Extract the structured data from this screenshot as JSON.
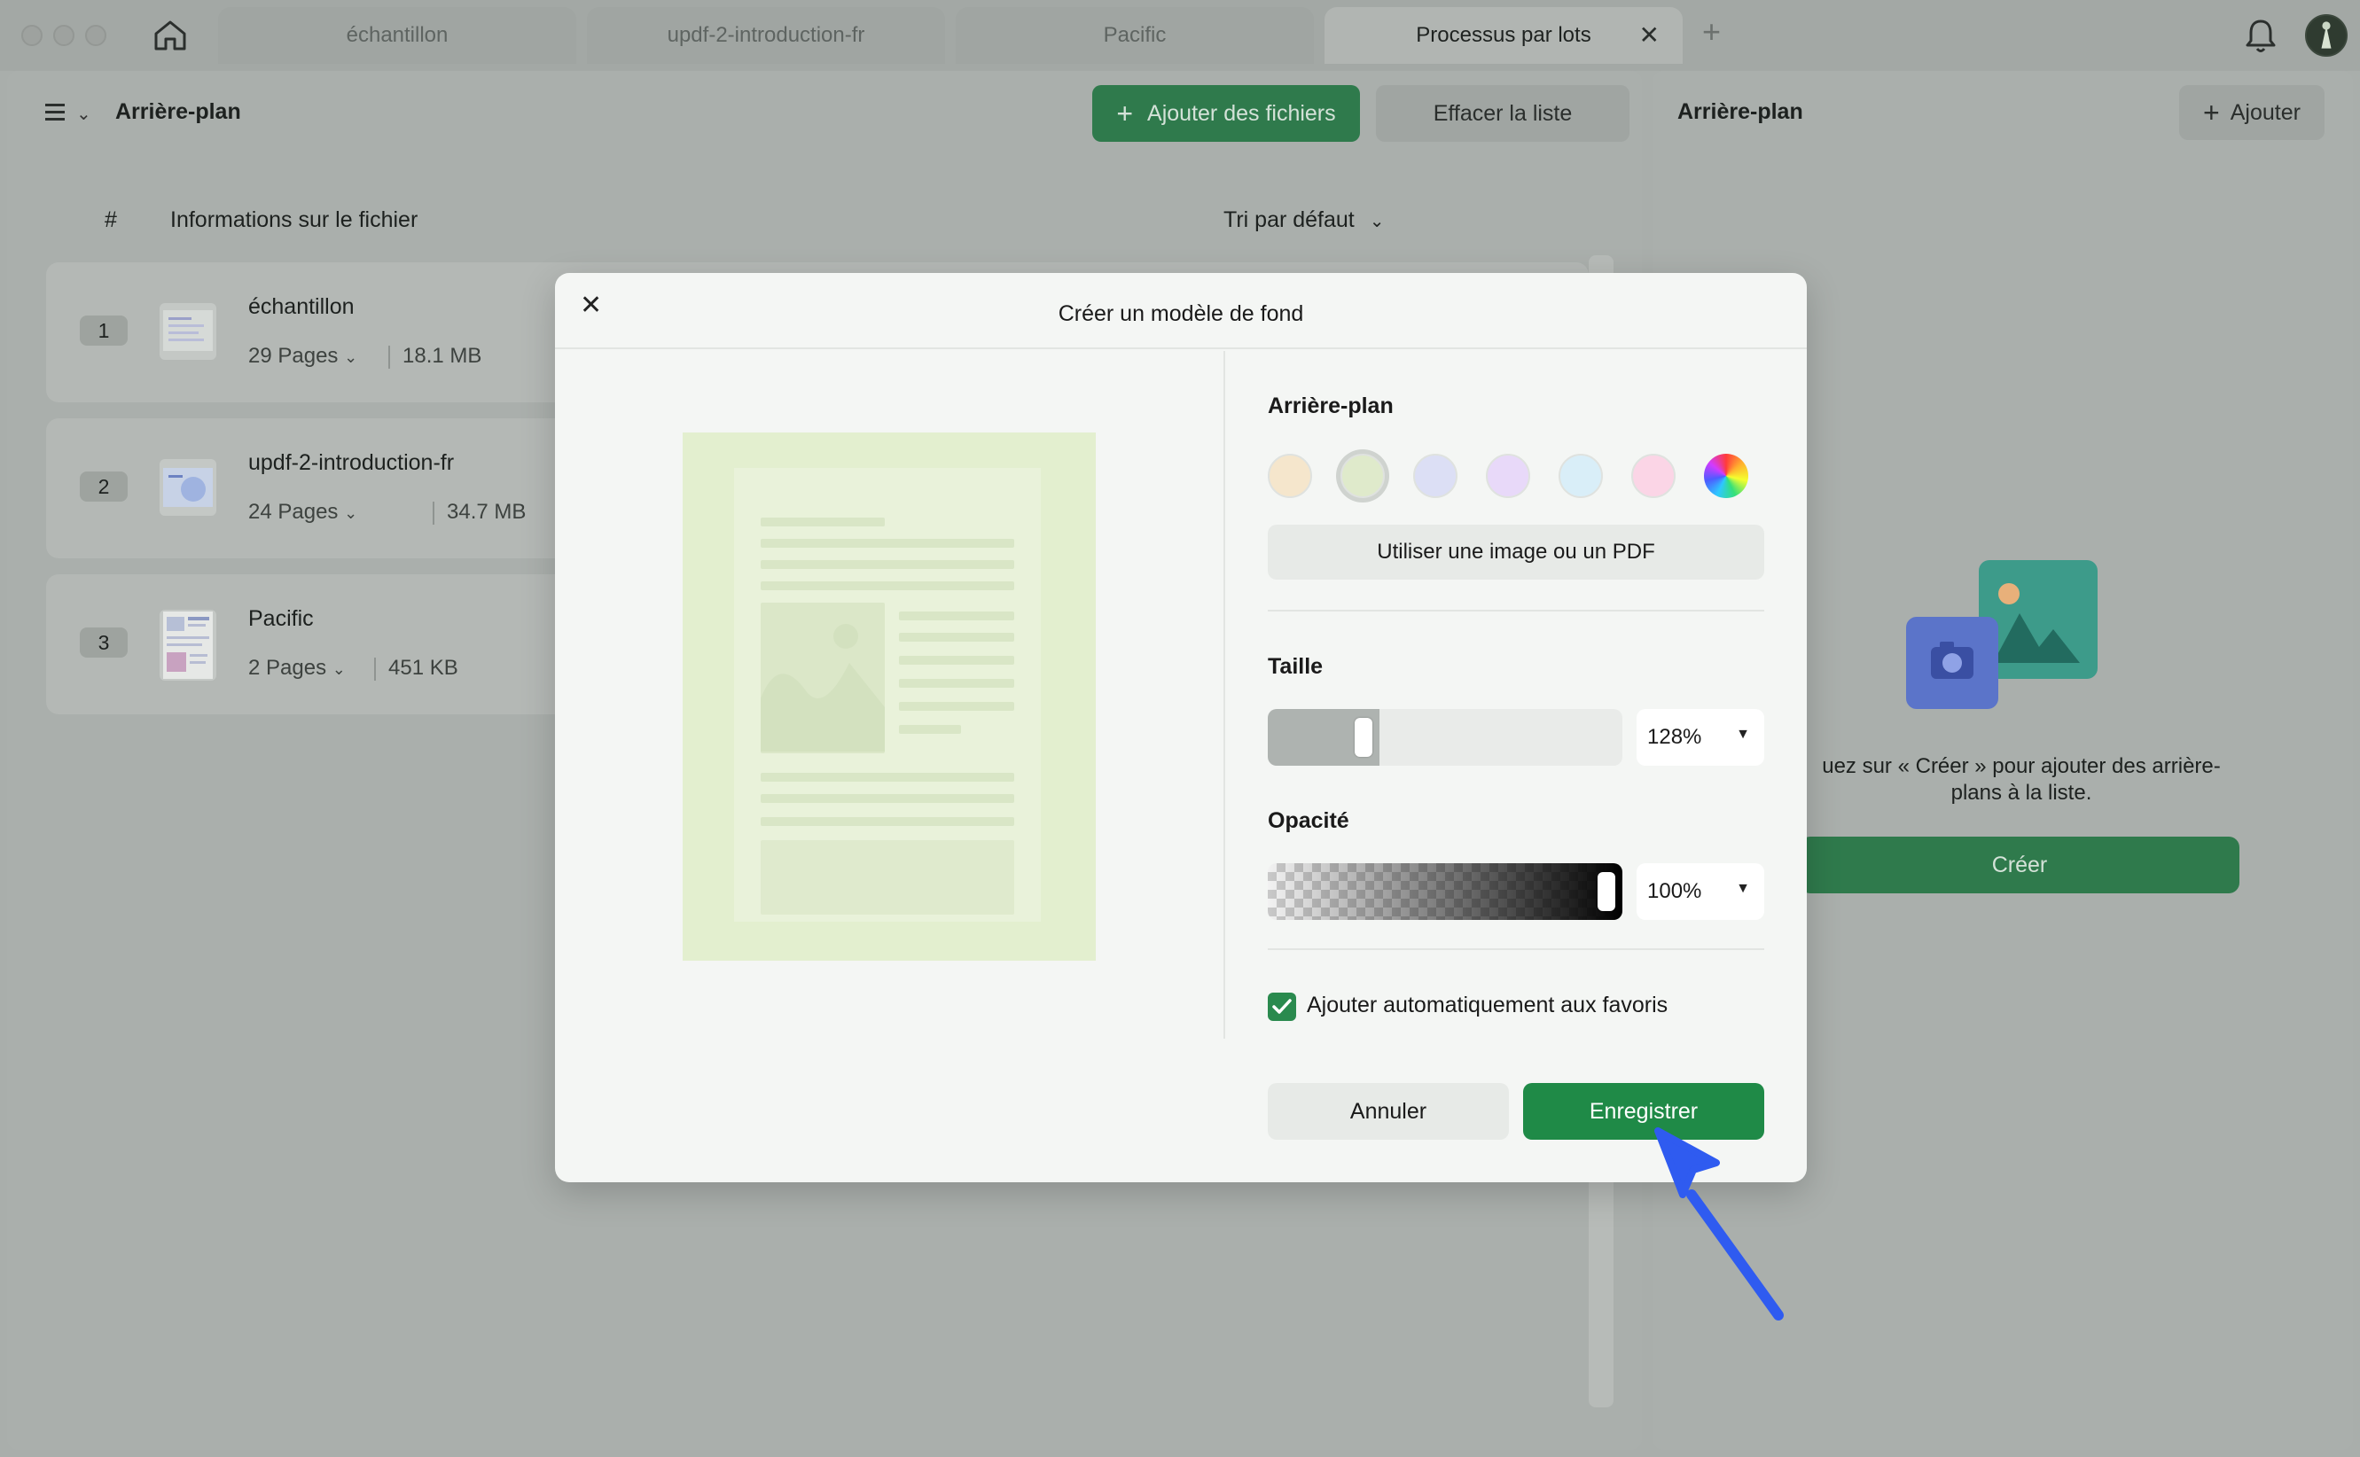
{
  "tabs": [
    {
      "label": "échantillon"
    },
    {
      "label": "updf-2-introduction-fr"
    },
    {
      "label": "Pacific"
    },
    {
      "label": "Processus par lots"
    }
  ],
  "left_panel": {
    "title": "Arrière-plan",
    "add_files_label": "Ajouter des fichiers",
    "clear_list_label": "Effacer la liste",
    "columns": {
      "hash": "#",
      "info": "Informations sur le fichier",
      "sort": "Tri par défaut"
    },
    "files": [
      {
        "num": "1",
        "name": "échantillon",
        "pages": "29 Pages",
        "size": "18.1 MB"
      },
      {
        "num": "2",
        "name": "updf-2-introduction-fr",
        "pages": "24 Pages",
        "size": "34.7 MB"
      },
      {
        "num": "3",
        "name": "Pacific",
        "pages": "2 Pages",
        "size": "451 KB"
      }
    ]
  },
  "right_panel": {
    "title": "Arrière-plan",
    "add_label": "Ajouter",
    "empty_text": "uez sur « Créer » pour ajouter des arrière-plans à la liste.",
    "create_label": "Créer"
  },
  "dialog": {
    "title": "Créer un modèle de fond",
    "background_label": "Arrière-plan",
    "swatches": [
      {
        "color": "#f5e6cc"
      },
      {
        "color": "#dfeacb",
        "selected": true
      },
      {
        "color": "#dcdff5"
      },
      {
        "color": "#e8d9f9"
      },
      {
        "color": "#d9eef8"
      },
      {
        "color": "#fbd5e6"
      },
      {
        "color": "rainbow"
      }
    ],
    "use_image_label": "Utiliser une image ou un PDF",
    "size_label": "Taille",
    "size_value": "128%",
    "size_fraction": 0.18,
    "opacity_label": "Opacité",
    "opacity_value": "100%",
    "opacity_fraction": 1.0,
    "favorites_label": "Ajouter automatiquement aux favoris",
    "favorites_checked": true,
    "cancel_label": "Annuler",
    "save_label": "Enregistrer"
  },
  "colors": {
    "accent": "#1f8a47",
    "pointer_arrow": "#2f5bf0"
  }
}
